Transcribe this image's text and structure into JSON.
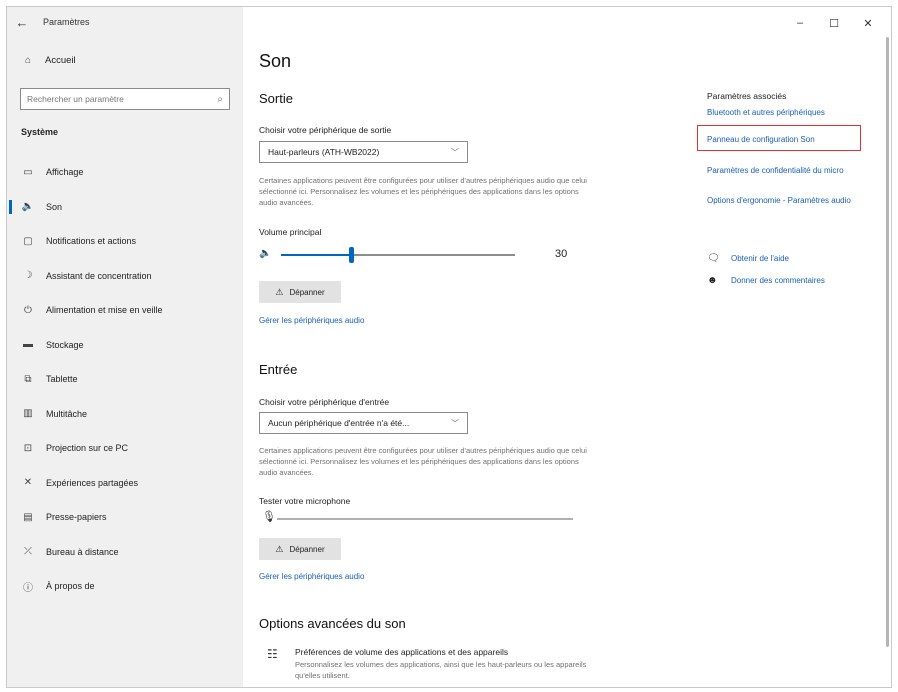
{
  "window": {
    "title": "Paramètres",
    "controls": {
      "minimize": "–",
      "maximize": "☐",
      "close": "✕"
    }
  },
  "sidebar": {
    "home_label": "Accueil",
    "search_placeholder": "Rechercher un paramètre",
    "section_label": "Système",
    "items": [
      {
        "label": "Affichage",
        "icon": "monitor-icon"
      },
      {
        "label": "Son",
        "icon": "speaker-icon",
        "active": true
      },
      {
        "label": "Notifications et actions",
        "icon": "notifications-icon"
      },
      {
        "label": "Assistant de concentration",
        "icon": "moon-icon"
      },
      {
        "label": "Alimentation et mise en veille",
        "icon": "power-icon"
      },
      {
        "label": "Stockage",
        "icon": "storage-icon"
      },
      {
        "label": "Tablette",
        "icon": "tablet-icon"
      },
      {
        "label": "Multitâche",
        "icon": "multitask-icon"
      },
      {
        "label": "Projection sur ce PC",
        "icon": "projection-icon"
      },
      {
        "label": "Expériences partagées",
        "icon": "shared-icon"
      },
      {
        "label": "Presse-papiers",
        "icon": "clipboard-icon"
      },
      {
        "label": "Bureau à distance",
        "icon": "remote-desktop-icon"
      },
      {
        "label": "À propos de",
        "icon": "info-icon"
      }
    ]
  },
  "main": {
    "page_title": "Son",
    "output": {
      "heading": "Sortie",
      "device_label": "Choisir votre périphérique de sortie",
      "device_value": "Haut-parleurs (ATH-WB2022)",
      "description": "Certaines applications peuvent être configurées pour utiliser d'autres périphériques audio que celui sélectionné ici. Personnalisez les volumes et les périphériques des applications dans les options audio avancées.",
      "volume_label": "Volume principal",
      "volume_value": "30",
      "volume_level": 0.3,
      "troubleshoot_label": "Dépanner",
      "manage_link": "Gérer les périphériques audio"
    },
    "input": {
      "heading": "Entrée",
      "device_label": "Choisir votre périphérique d'entrée",
      "device_value": "Aucun périphérique d'entrée n'a été...",
      "description": "Certaines applications peuvent être configurées pour utiliser d'autres périphériques audio que celui sélectionné ici. Personnalisez les volumes et les périphériques des applications dans les options audio avancées.",
      "mic_label": "Tester votre microphone",
      "mic_level": 0.0,
      "troubleshoot_label": "Dépanner",
      "manage_link": "Gérer les périphériques audio"
    },
    "advanced": {
      "heading": "Options avancées du son",
      "item_title": "Préférences de volume des applications et des appareils",
      "item_desc": "Personnalisez les volumes des applications, ainsi que les haut-parleurs ou les appareils qu'elles utilisent."
    }
  },
  "related": {
    "heading": "Paramètres associés",
    "links": [
      "Bluetooth et autres périphériques",
      "Panneau de configuration Son",
      "Paramètres de confidentialité du micro",
      "Options d'ergonomie - Paramètres audio"
    ],
    "help_label": "Obtenir de l'aide",
    "feedback_label": "Donner des commentaires"
  },
  "colors": {
    "accent": "#0067c0",
    "link": "#1a5fb4",
    "highlight_border": "#dd3333",
    "sidebar_bg": "#f0f0f0"
  }
}
